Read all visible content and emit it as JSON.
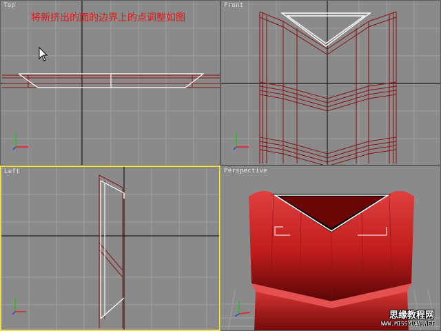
{
  "viewports": {
    "top": {
      "label": "Top"
    },
    "front": {
      "label": "Front"
    },
    "left": {
      "label": "Left"
    },
    "perspective": {
      "label": "Perspective"
    }
  },
  "caption": "将新挤出的面的边界上的点调整如图",
  "active_viewport": "left",
  "watermark": {
    "site_name": "思缘教程网",
    "url": "WWW.MISSYUAN.NET"
  },
  "colors": {
    "viewport_bg": "#8a8a8a",
    "grid": "#a0a0a0",
    "wire": "#8b1010",
    "selection": "#ffffff",
    "active_border": "#f0e040",
    "caption": "#e01818"
  }
}
